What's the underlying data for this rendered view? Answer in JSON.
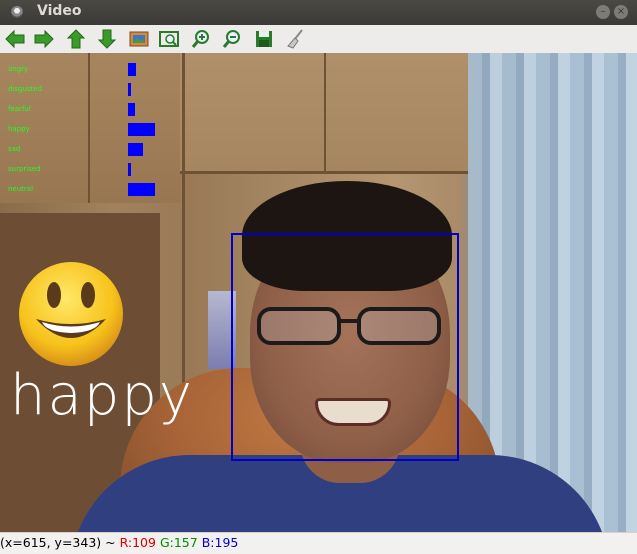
{
  "window": {
    "title": "Video"
  },
  "toolbar": {
    "buttons": [
      {
        "name": "back-arrow-icon",
        "color": "#3a9a2a"
      },
      {
        "name": "forward-arrow-icon",
        "color": "#3a9a2a"
      },
      {
        "name": "up-arrow-icon",
        "color": "#3a9a2a"
      },
      {
        "name": "down-arrow-icon",
        "color": "#3a9a2a"
      },
      {
        "name": "image-icon",
        "color": "#b0642c"
      },
      {
        "name": "zoom-fit-icon",
        "color": "#2b7a2b"
      },
      {
        "name": "zoom-in-icon",
        "color": "#2b7a2b"
      },
      {
        "name": "zoom-out-icon",
        "color": "#2b7a2b"
      },
      {
        "name": "save-icon",
        "color": "#2b7a2b"
      },
      {
        "name": "broom-icon",
        "color": "#7a7a7a"
      }
    ]
  },
  "emotions": [
    {
      "label": "angry",
      "score": 0.3
    },
    {
      "label": "disgusted",
      "score": 0.1
    },
    {
      "label": "fearful",
      "score": 0.25
    },
    {
      "label": "happy",
      "score": 0.95
    },
    {
      "label": "sad",
      "score": 0.55
    },
    {
      "label": "surprised",
      "score": 0.08
    },
    {
      "label": "neutral",
      "score": 0.95
    }
  ],
  "detected_emotion": "happy",
  "status": {
    "coords": "(x=615, y=343) ~",
    "r": "R:109",
    "g": "G:157",
    "b": "B:195"
  },
  "colors": {
    "emotion_text": "#22ff22",
    "bars": "#0000ff",
    "face_box": "#0000c8",
    "r": "#d40000",
    "g": "#008c00",
    "b": "#0000d4"
  }
}
